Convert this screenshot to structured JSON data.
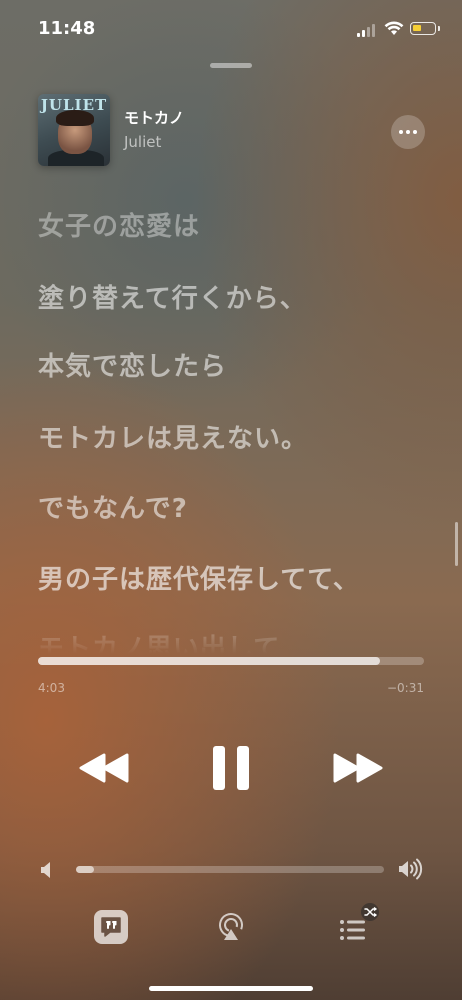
{
  "status_bar": {
    "time": "11:48",
    "battery_level": 0.45
  },
  "now_playing": {
    "title": "モトカノ",
    "artist": "Juliet",
    "album_art": {
      "title_text": "JULIET"
    }
  },
  "lyrics": [
    "女子の恋愛は",
    "塗り替えて行くから、",
    "本気で恋したら",
    "モトカレは見えない。",
    "でもなんで?",
    "男の子は歴代保存してて、",
    "モトカノ思い出して"
  ],
  "playback": {
    "elapsed": "4:03",
    "remaining": "−0:31",
    "progress_fraction": 0.887,
    "state": "playing"
  },
  "volume": {
    "level_fraction": 0.06
  },
  "icons": {
    "more": "ellipsis-icon",
    "rewind": "rewind-icon",
    "pause": "pause-icon",
    "fast_forward": "fast-forward-icon",
    "volume_low": "speaker-low-icon",
    "volume_high": "speaker-high-icon",
    "lyrics": "lyrics-quote-icon",
    "airplay": "airplay-icon",
    "queue": "queue-list-icon",
    "shuffle_badge": "shuffle-icon"
  },
  "colors": {
    "battery": "#f6cf36",
    "accent": "#ffffff"
  }
}
